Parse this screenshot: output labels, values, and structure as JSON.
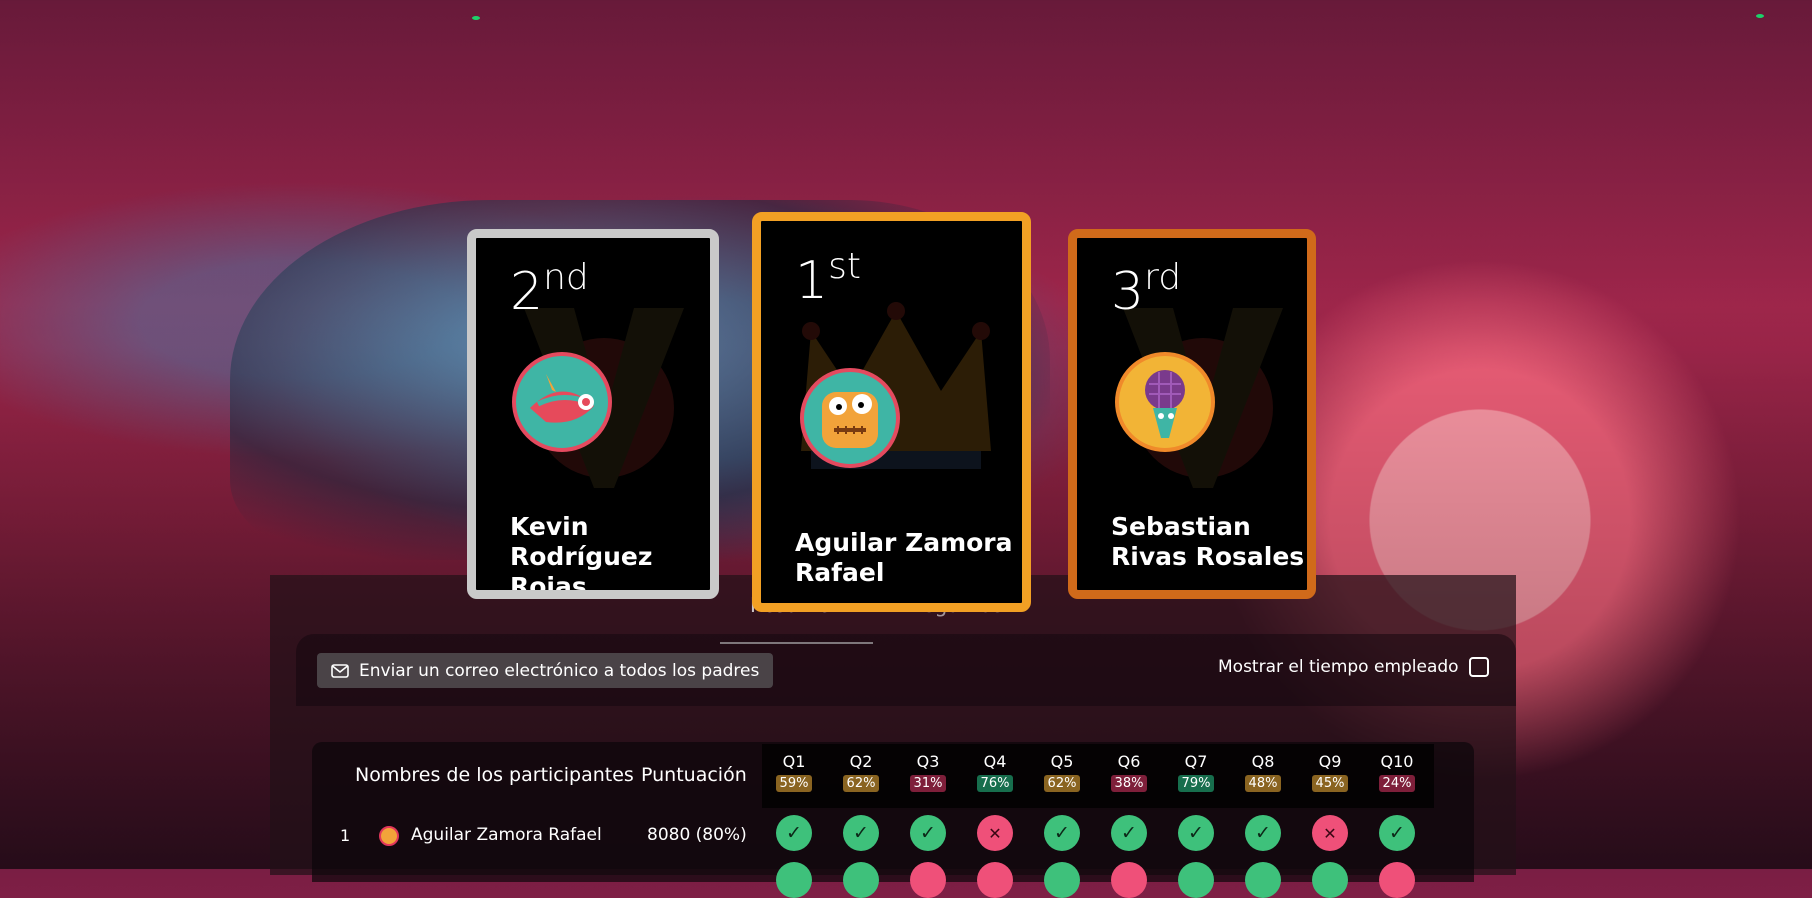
{
  "podium": [
    {
      "rank_num": "2",
      "rank_suffix": "nd",
      "name": "Kevin Rodríguez Rojas",
      "border": "#c9c9c9",
      "avatar": "pilgrim-hat-avatar"
    },
    {
      "rank_num": "1",
      "rank_suffix": "st",
      "name": "Aguilar Zamora Rafael",
      "border": "#f2a024",
      "avatar": "orange-monster-avatar"
    },
    {
      "rank_num": "3",
      "rank_suffix": "rd",
      "name": "Sebastian Rivas Rosales",
      "border": "#d06a1a",
      "avatar": "microphone-avatar"
    }
  ],
  "tabs": [
    {
      "label": "Resumen",
      "active": true
    },
    {
      "label": "Preguntas",
      "active": false
    }
  ],
  "toolbar": {
    "email_button": "Enviar un correo electrónico a todos los padres",
    "show_time_label": "Mostrar el tiempo empleado"
  },
  "table": {
    "header_name": "Nombres de los participantes",
    "header_score": "Puntuación",
    "questions": [
      {
        "label": "Q1",
        "pct": "59%",
        "color": "#8a6421"
      },
      {
        "label": "Q2",
        "pct": "62%",
        "color": "#8a6421"
      },
      {
        "label": "Q3",
        "pct": "31%",
        "color": "#7e1f3a"
      },
      {
        "label": "Q4",
        "pct": "76%",
        "color": "#176e4d"
      },
      {
        "label": "Q5",
        "pct": "62%",
        "color": "#8a6421"
      },
      {
        "label": "Q6",
        "pct": "38%",
        "color": "#7e1f3a"
      },
      {
        "label": "Q7",
        "pct": "79%",
        "color": "#176e4d"
      },
      {
        "label": "Q8",
        "pct": "48%",
        "color": "#8a6421"
      },
      {
        "label": "Q9",
        "pct": "45%",
        "color": "#8a6421"
      },
      {
        "label": "Q10",
        "pct": "24%",
        "color": "#7e1f3a"
      }
    ],
    "rows": [
      {
        "rank": "1",
        "name": "Aguilar Zamora Rafael",
        "score": "8080 (80%)",
        "answers": [
          "ok",
          "ok",
          "ok",
          "bad",
          "ok",
          "ok",
          "ok",
          "ok",
          "bad",
          "ok"
        ]
      }
    ]
  }
}
